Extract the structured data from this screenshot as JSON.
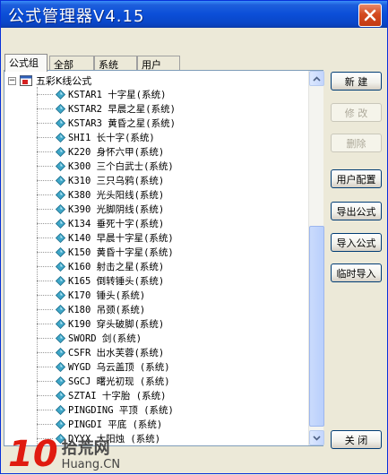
{
  "window": {
    "title": "公式管理器V4.15"
  },
  "tabs": [
    "公式组",
    "全部",
    "系统",
    "用户"
  ],
  "tree": {
    "root_label": "五彩K线公式",
    "items": [
      "KSTAR1  十字星(系统)",
      "KSTAR2  早晨之星(系统)",
      "KSTAR3  黄昏之星(系统)",
      "SHI1   长十字(系统)",
      "K220   身怀六甲(系统)",
      "K300   三个白武士(系统)",
      "K310   三只乌鸦(系统)",
      "K380   光头阳线(系统)",
      "K390   光脚阴线(系统)",
      "K134   垂死十字(系统)",
      "K140   早晨十字星(系统)",
      "K150   黄昏十字星(系统)",
      "K160   射击之星(系统)",
      "K165   倒转锤头(系统)",
      "K170   锤头(系统)",
      "K180   吊颈(系统)",
      "K190   穿头破脚(系统)",
      "SWORD  剑(系统)",
      "CSFR   出水芙蓉(系统)",
      "WYGD   乌云盖顶 (系统)",
      "SGCJ   曙光初现 (系统)",
      "SZTAI   十字胎 (系统)",
      "PINGDING  平顶 (系统)",
      "PINGDI  平底 (系统)",
      "DYYX   大阳烛 (系统)"
    ]
  },
  "buttons": {
    "new": "新 建",
    "edit": "修 改",
    "delete": "删除",
    "user_config": "用户配置",
    "export": "导出公式",
    "import": "导入公式",
    "temp_import": "临时导入",
    "close": "关 闭"
  },
  "watermark": {
    "number": "10",
    "cn": "拾荒网",
    "en": "Huang.CN"
  },
  "colors": {
    "titlebar": "#0B4FD8",
    "gem": "#3FA7C8",
    "watermark_red": "#E01B10"
  }
}
